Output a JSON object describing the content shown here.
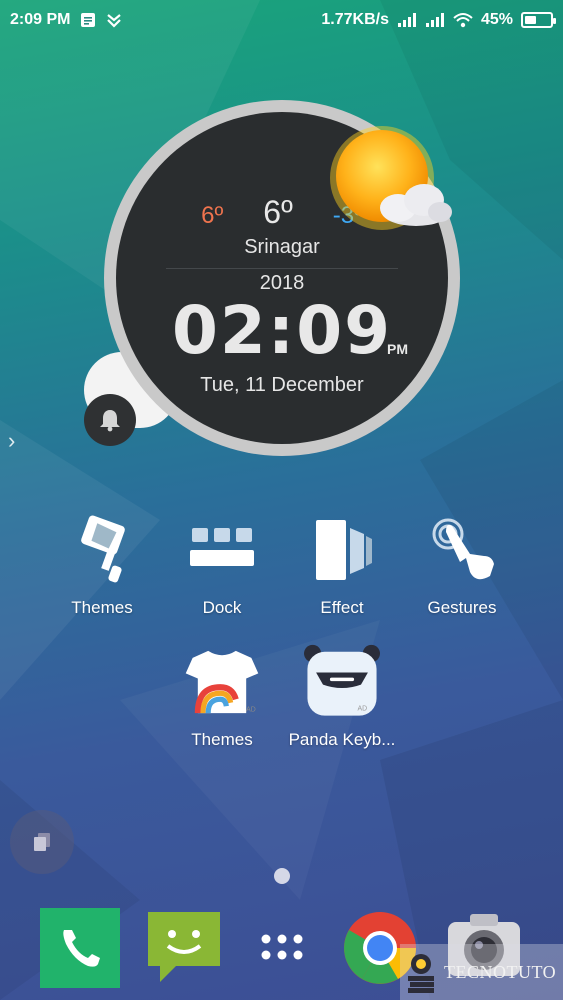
{
  "status_bar": {
    "time": "2:09 PM",
    "net_speed": "1.77KB/s",
    "battery": "45%",
    "battery_level": 0.45
  },
  "widget": {
    "low_temp": "6º",
    "current_temp": "6º",
    "high_temp": "-3º",
    "city": "Srinagar",
    "year": "2018",
    "time": "02:09",
    "ampm": "PM",
    "date": "Tue, 11 December"
  },
  "apps_row1": [
    {
      "label": "Themes",
      "icon": "paint-roller-icon"
    },
    {
      "label": "Dock",
      "icon": "dock-icon"
    },
    {
      "label": "Effect",
      "icon": "effect-icon"
    },
    {
      "label": "Gestures",
      "icon": "gesture-hand-icon"
    }
  ],
  "apps_row2": [
    {
      "label": "Themes",
      "icon": "tshirt-rainbow-icon"
    },
    {
      "label": "Panda Keyb...",
      "icon": "panda-keyboard-icon"
    }
  ],
  "dock": [
    {
      "name": "phone",
      "icon": "phone-icon"
    },
    {
      "name": "messages",
      "icon": "messages-icon"
    },
    {
      "name": "app-drawer",
      "icon": "app-drawer-icon"
    },
    {
      "name": "chrome",
      "icon": "chrome-icon"
    },
    {
      "name": "camera",
      "icon": "camera-icon"
    }
  ],
  "watermark": "TECNOTUTO",
  "colors": {
    "low_temp": "#f0744e",
    "high_temp": "#3fa9f5",
    "phone_green": "#21b36b",
    "messages_green": "#8ab735"
  }
}
